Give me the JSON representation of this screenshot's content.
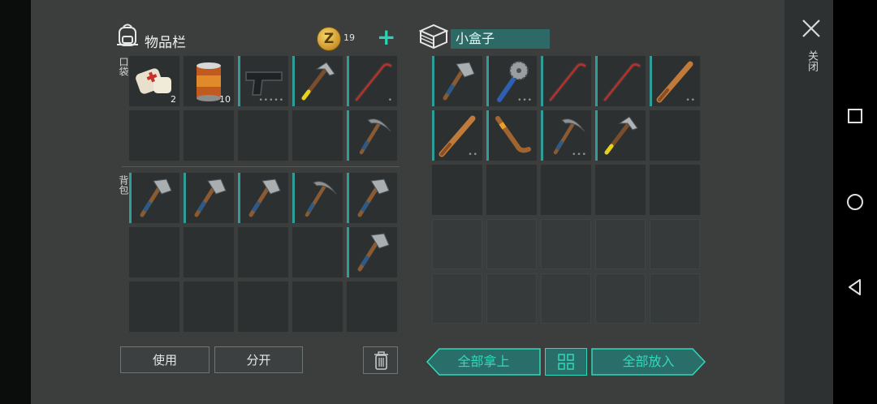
{
  "inventory": {
    "title": "物品栏",
    "coins": "19",
    "coin_glyph": "Z",
    "pocket_label": "口袋",
    "backpack_label": "背包",
    "pocket": [
      {
        "item": "bandage-icon",
        "qty": "2",
        "bar": false
      },
      {
        "item": "canned-food-icon",
        "qty": "10",
        "bar": false
      },
      {
        "item": "pistol-icon",
        "qty": "",
        "bar": true,
        "dots": "•••••"
      },
      {
        "item": "hammer-icon",
        "qty": "",
        "bar": true
      },
      {
        "item": "crowbar-icon",
        "qty": "",
        "bar": true,
        "dots": "•"
      },
      {
        "item": "",
        "qty": "",
        "bar": false
      },
      {
        "item": "",
        "qty": "",
        "bar": false
      },
      {
        "item": "",
        "qty": "",
        "bar": false
      },
      {
        "item": "",
        "qty": "",
        "bar": false
      },
      {
        "item": "pickaxe-icon",
        "qty": "",
        "bar": true
      }
    ],
    "backpack": [
      {
        "item": "axe-icon",
        "qty": "",
        "bar": true
      },
      {
        "item": "axe-icon",
        "qty": "",
        "bar": true
      },
      {
        "item": "axe-icon",
        "qty": "",
        "bar": true
      },
      {
        "item": "pickaxe-icon",
        "qty": "",
        "bar": true
      },
      {
        "item": "axe-icon",
        "qty": "",
        "bar": true
      },
      {
        "item": "",
        "qty": "",
        "bar": false
      },
      {
        "item": "",
        "qty": "",
        "bar": false
      },
      {
        "item": "",
        "qty": "",
        "bar": false
      },
      {
        "item": "",
        "qty": "",
        "bar": false
      },
      {
        "item": "axe-icon",
        "qty": "",
        "bar": true
      },
      {
        "item": "",
        "qty": "",
        "bar": false
      },
      {
        "item": "",
        "qty": "",
        "bar": false
      },
      {
        "item": "",
        "qty": "",
        "bar": false
      },
      {
        "item": "",
        "qty": "",
        "bar": false
      },
      {
        "item": "",
        "qty": "",
        "bar": false
      }
    ],
    "use_label": "使用",
    "split_label": "分开"
  },
  "container": {
    "name": "小盒子",
    "items": [
      {
        "item": "axe-icon",
        "qty": "",
        "bar": true
      },
      {
        "item": "saw-club-icon",
        "qty": "",
        "bar": true,
        "dots": "•••"
      },
      {
        "item": "crowbar-icon",
        "qty": "",
        "bar": true
      },
      {
        "item": "crowbar-icon",
        "qty": "",
        "bar": true
      },
      {
        "item": "baseball-bat-icon",
        "qty": "",
        "bar": true,
        "dots": "••"
      },
      {
        "item": "baseball-bat-icon",
        "qty": "",
        "bar": true,
        "dots": "••"
      },
      {
        "item": "hockey-stick-icon",
        "qty": "",
        "bar": true
      },
      {
        "item": "pickaxe-icon",
        "qty": "",
        "bar": true,
        "dots": "•••"
      },
      {
        "item": "hammer-icon",
        "qty": "",
        "bar": true
      },
      {
        "item": "",
        "qty": "",
        "bar": false
      }
    ],
    "take_all_label": "全部拿上",
    "put_all_label": "全部放入"
  },
  "close_label": "关闭",
  "colors": {
    "accent": "#2fd9bb",
    "panel": "#3b3e3d",
    "cell": "#2d3031",
    "bar": "#2f9e98"
  }
}
